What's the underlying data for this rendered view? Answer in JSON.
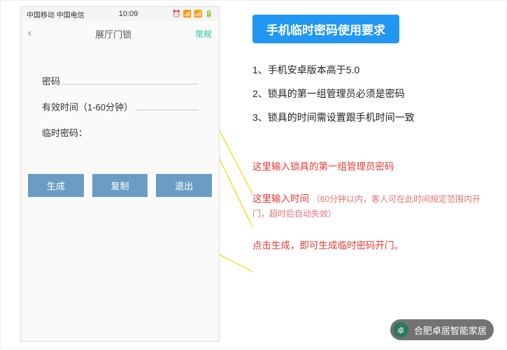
{
  "phone": {
    "status": {
      "carriers": "中国移动 中国电信",
      "time": "10:09",
      "icons": [
        "alarm-icon",
        "signal-icon",
        "signal-icon",
        "battery-icon"
      ]
    },
    "nav": {
      "back": "‹",
      "title": "展厅门锁",
      "action": "常规"
    },
    "fields": {
      "password_label": "密码",
      "valid_time_label": "有效时间（1-60分钟）",
      "temp_password_label": "临时密码："
    },
    "buttons": {
      "generate": "生成",
      "copy": "复制",
      "exit": "退出"
    }
  },
  "right": {
    "title": "手机临时密码使用要求",
    "requirements": [
      "1、手机安卓版本高于5.0",
      "2、锁具的第一组管理员必须是密码",
      "3、锁具的时间需设置跟手机时间一致"
    ],
    "annotations": {
      "a1": "这里输入锁具的第一组管理员密码",
      "a2_main": "这里输入时间",
      "a2_note": "（60分钟以内，客人可在此时间规定范围内开门，超时后自动失效）",
      "a3": "点击生成，即可生成临时密码开门。"
    }
  },
  "footer": {
    "brand": "合肥卓居智能家居",
    "brand_short": "卓"
  }
}
